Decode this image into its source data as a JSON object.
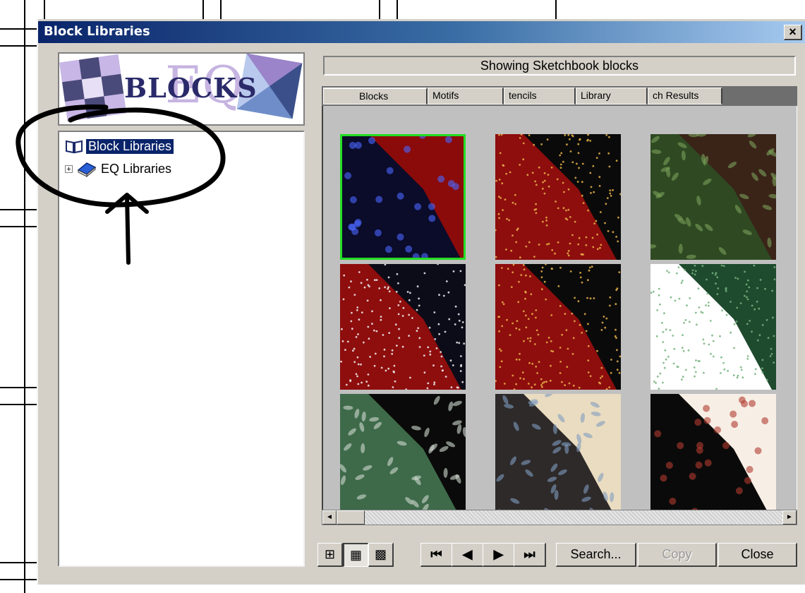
{
  "window": {
    "title": "Block Libraries",
    "close_glyph": "×"
  },
  "logo": {
    "text": "BLOCKS",
    "eq_text": "EQ"
  },
  "tree": {
    "root_label": "Block Libraries",
    "root_icon": "open-book-icon",
    "child_label": "EQ Libraries",
    "child_icon": "book-icon",
    "expander_glyph": "+"
  },
  "gallery": {
    "heading": "Showing Sketchbook blocks",
    "tabs": [
      {
        "label": "Blocks",
        "active": true
      },
      {
        "label": "Motifs",
        "active": false
      },
      {
        "label": "tencils",
        "active": false
      },
      {
        "label": "Library",
        "active": false
      },
      {
        "label": "ch Results",
        "active": false
      }
    ],
    "selected_index": 0,
    "tiles": [
      {
        "main": "#0b0b2a",
        "corner": "#8b0a0a",
        "dots": "#4a68ff",
        "pattern": "floral"
      },
      {
        "main": "#8e0d0d",
        "corner": "#0a0a0a",
        "dots": "#e8b24a",
        "pattern": "dots"
      },
      {
        "main": "#2f4a22",
        "corner": "#3a2418",
        "dots": "#7aa05a",
        "pattern": "leaf"
      },
      {
        "main": "#8e0d0d",
        "corner": "#0c0c18",
        "dots": "#f0f0f0",
        "pattern": "dots"
      },
      {
        "main": "#8e0d0d",
        "corner": "#0a0a0a",
        "dots": "#e8b24a",
        "pattern": "dots"
      },
      {
        "main": "#ffffff",
        "corner": "#1e4a2e",
        "dots": "#76b37c",
        "pattern": "dots"
      },
      {
        "main": "#3e6a4a",
        "corner": "#0a0a0a",
        "dots": "#cfd8cf",
        "pattern": "leaf"
      },
      {
        "main": "#2e2a2a",
        "corner": "#eadcc0",
        "dots": "#7e9cc0",
        "pattern": "leaf"
      },
      {
        "main": "#0a0a0a",
        "corner": "#f7efe6",
        "dots": "#b03a2e",
        "pattern": "floral"
      }
    ]
  },
  "scrollbar": {
    "left_glyph": "◄",
    "right_glyph": "►"
  },
  "toolbar": {
    "view_buttons": [
      {
        "glyph": "⊞",
        "name": "view-large-icon",
        "pressed": false
      },
      {
        "glyph": "▦",
        "name": "view-medium-icon",
        "pressed": true
      },
      {
        "glyph": "▩",
        "name": "view-small-icon",
        "pressed": false
      }
    ],
    "nav_buttons": [
      {
        "glyph": "⏮",
        "name": "first-page-button"
      },
      {
        "glyph": "◀",
        "name": "previous-page-button"
      },
      {
        "glyph": "▶",
        "name": "next-page-button"
      },
      {
        "glyph": "⏭",
        "name": "last-page-button"
      }
    ],
    "search_label": "Search...",
    "copy_label": "Copy",
    "close_label": "Close"
  },
  "colors": {
    "selection_outline": "#22dd22",
    "title_gradient_start": "#0a246a",
    "tree_selection": "#0a246a"
  }
}
